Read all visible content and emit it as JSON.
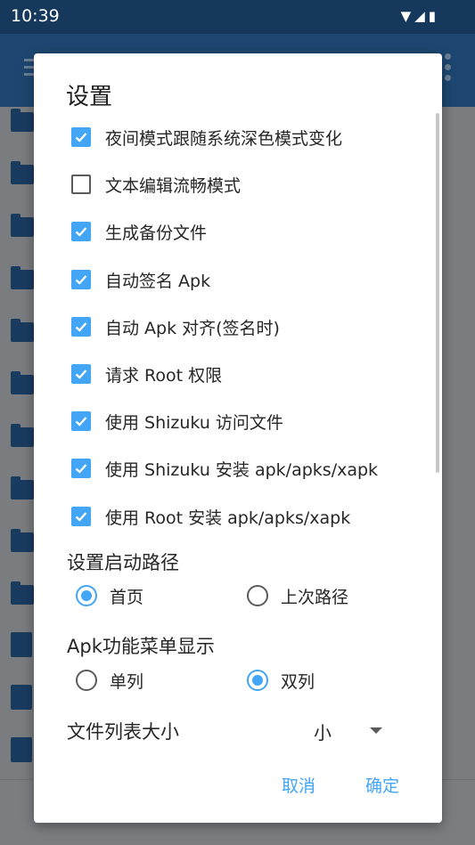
{
  "status_bar": {
    "time": "10:39",
    "icons": "▼◢▮"
  },
  "dialog": {
    "title": "设置",
    "checkboxes": [
      {
        "label": "夜间模式跟随系统深色模式变化",
        "checked": true
      },
      {
        "label": "文本编辑流畅模式",
        "checked": false
      },
      {
        "label": "生成备份文件",
        "checked": true
      },
      {
        "label": "自动签名 Apk",
        "checked": true
      },
      {
        "label": "自动 Apk 对齐(签名时)",
        "checked": true
      },
      {
        "label": "请求 Root 权限",
        "checked": true
      },
      {
        "label": "使用 Shizuku 访问文件",
        "checked": true
      },
      {
        "label": "使用 Shizuku 安装 apk/apks/xapk",
        "checked": true
      },
      {
        "label": "使用 Root 安装 apk/apks/xapk",
        "checked": true
      }
    ],
    "startup_path": {
      "label": "设置启动路径",
      "options": [
        {
          "label": "首页",
          "selected": true
        },
        {
          "label": "上次路径",
          "selected": false
        }
      ]
    },
    "apk_menu": {
      "label": "Apk功能菜单显示",
      "options": [
        {
          "label": "单列",
          "selected": false
        },
        {
          "label": "双列",
          "selected": true
        }
      ]
    },
    "file_list_size": {
      "label": "文件列表大小",
      "value": "小"
    },
    "cancel_label": "取消",
    "ok_label": "确定"
  },
  "colors": {
    "accent": "#42a5f5",
    "appbar": "#1d4770",
    "statusbar": "#16385d"
  }
}
